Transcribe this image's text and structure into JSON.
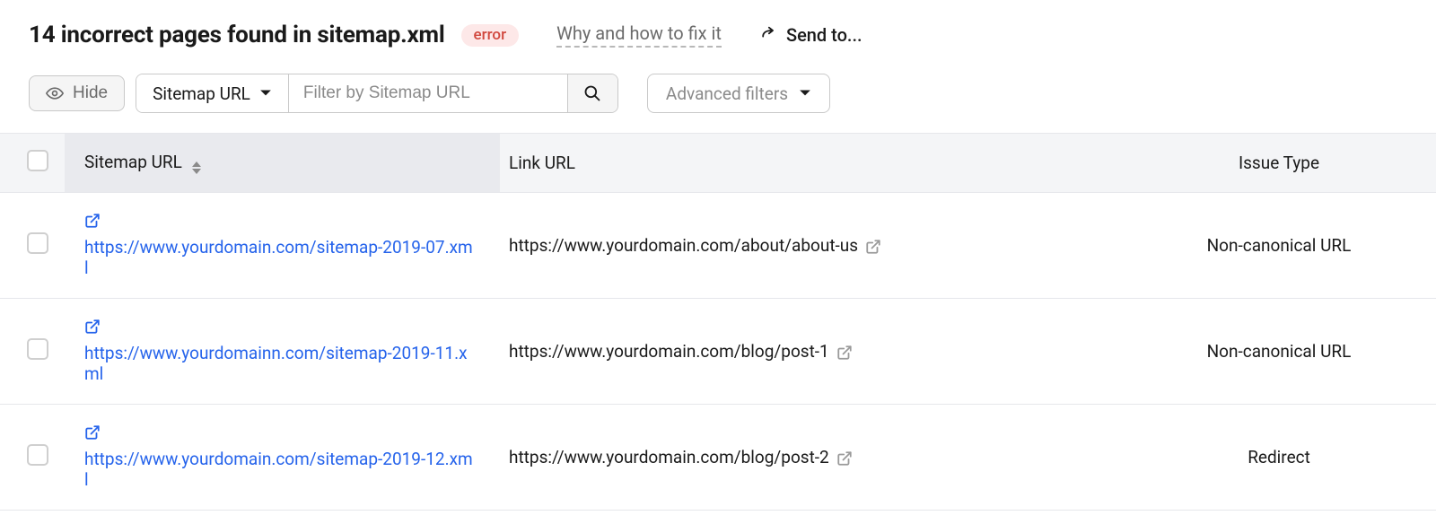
{
  "header": {
    "title": "14 incorrect pages found in sitemap.xml",
    "badge": "error",
    "help_link": "Why and how to fix it",
    "send_to": "Send to..."
  },
  "toolbar": {
    "hide_label": "Hide",
    "filter_select": "Sitemap URL",
    "filter_placeholder": "Filter by Sitemap URL",
    "advanced_filters": "Advanced filters"
  },
  "table": {
    "columns": {
      "sitemap_url": "Sitemap URL",
      "link_url": "Link URL",
      "issue_type": "Issue Type"
    },
    "rows": [
      {
        "sitemap_url": "https://www.yourdomain.com/sitemap-2019-07.xml",
        "link_url": "https://www.yourdomain.com/about/about-us",
        "issue_type": "Non-canonical URL"
      },
      {
        "sitemap_url": "https://www.yourdomainn.com/sitemap-2019-11.xml",
        "link_url": "https://www.yourdomain.com/blog/post-1",
        "issue_type": "Non-canonical URL"
      },
      {
        "sitemap_url": "https://www.yourdomain.com/sitemap-2019-12.xml",
        "link_url": "https://www.yourdomain.com/blog/post-2",
        "issue_type": "Redirect"
      }
    ]
  }
}
